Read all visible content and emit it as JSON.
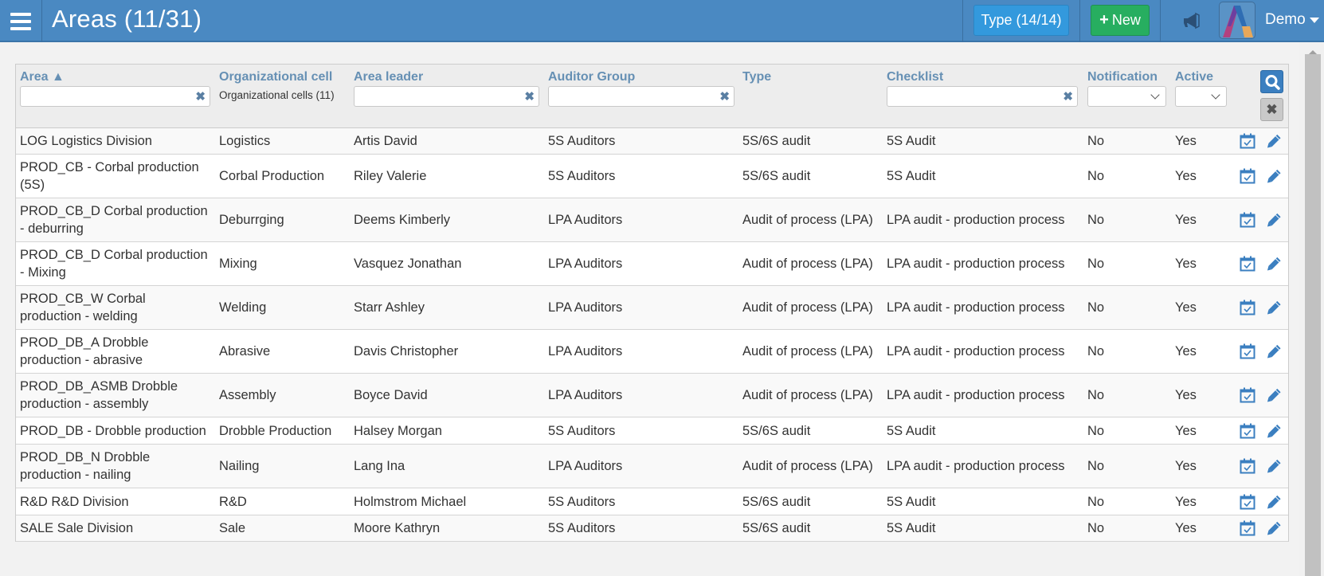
{
  "header": {
    "title": "Areas (11/31)",
    "type_button": "Type (14/14)",
    "new_button_icon": "+",
    "new_button": "New",
    "user": "Demo",
    "colors": {
      "bar": "#4a89c2",
      "type_button": "#3399dd",
      "new_button": "#27ae60"
    }
  },
  "filters": {
    "columns": [
      {
        "label": "Area ▲"
      },
      {
        "label": "Organizational cell"
      },
      {
        "label": "Area leader"
      },
      {
        "label": "Auditor Group"
      },
      {
        "label": "Type"
      },
      {
        "label": "Checklist"
      },
      {
        "label": "Notification"
      },
      {
        "label": "Active"
      }
    ],
    "area_value": "",
    "org_cells_summary": "Organizational cells (11)",
    "leader_value": "",
    "auditor_value": "",
    "checklist_value": "",
    "notification_value": "",
    "active_value": "",
    "clear_glyph": "✖"
  },
  "rows": [
    {
      "area": "LOG Logistics Division",
      "org": "Logistics",
      "leader": "Artis David",
      "group": "5S Auditors",
      "type": "5S/6S audit",
      "checklist": "5S Audit",
      "notification": "No",
      "active": "Yes"
    },
    {
      "area": "PROD_CB - Corbal production (5S)",
      "org": "Corbal Production",
      "leader": "Riley Valerie",
      "group": "5S Auditors",
      "type": "5S/6S audit",
      "checklist": "5S Audit",
      "notification": "No",
      "active": "Yes"
    },
    {
      "area": "PROD_CB_D Corbal production - deburring",
      "org": "Deburrging",
      "leader": "Deems Kimberly",
      "group": "LPA Auditors",
      "type": "Audit of process (LPA)",
      "checklist": "LPA audit - production process",
      "notification": "No",
      "active": "Yes"
    },
    {
      "area": "PROD_CB_D Corbal production - Mixing",
      "org": "Mixing",
      "leader": "Vasquez Jonathan",
      "group": "LPA Auditors",
      "type": "Audit of process (LPA)",
      "checklist": "LPA audit - production process",
      "notification": "No",
      "active": "Yes"
    },
    {
      "area": "PROD_CB_W Corbal production - welding",
      "org": "Welding",
      "leader": "Starr Ashley",
      "group": "LPA Auditors",
      "type": "Audit of process (LPA)",
      "checklist": "LPA audit - production process",
      "notification": "No",
      "active": "Yes"
    },
    {
      "area": "PROD_DB_A Drobble production - abrasive",
      "org": "Abrasive",
      "leader": "Davis Christopher",
      "group": "LPA Auditors",
      "type": "Audit of process (LPA)",
      "checklist": "LPA audit - production process",
      "notification": "No",
      "active": "Yes"
    },
    {
      "area": "PROD_DB_ASMB Drobble production - assembly",
      "org": "Assembly",
      "leader": "Boyce David",
      "group": "LPA Auditors",
      "type": "Audit of process (LPA)",
      "checklist": "LPA audit - production process",
      "notification": "No",
      "active": "Yes"
    },
    {
      "area": "PROD_DB - Drobble production",
      "org": "Drobble Production",
      "leader": "Halsey Morgan",
      "group": "5S Auditors",
      "type": "5S/6S audit",
      "checklist": "5S Audit",
      "notification": "No",
      "active": "Yes"
    },
    {
      "area": "PROD_DB_N Drobble production - nailing",
      "org": "Nailing",
      "leader": "Lang Ina",
      "group": "LPA Auditors",
      "type": "Audit of process (LPA)",
      "checklist": "LPA audit - production process",
      "notification": "No",
      "active": "Yes"
    },
    {
      "area": "R&D R&D Division",
      "org": "R&D",
      "leader": "Holmstrom Michael",
      "group": "5S Auditors",
      "type": "5S/6S audit",
      "checklist": "5S Audit",
      "notification": "No",
      "active": "Yes"
    },
    {
      "area": "SALE Sale Division",
      "org": "Sale",
      "leader": "Moore Kathryn",
      "group": "5S Auditors",
      "type": "5S/6S audit",
      "checklist": "5S Audit",
      "notification": "No",
      "active": "Yes"
    }
  ],
  "row_icons": [
    "calendar-check-icon",
    "pencil-icon"
  ]
}
